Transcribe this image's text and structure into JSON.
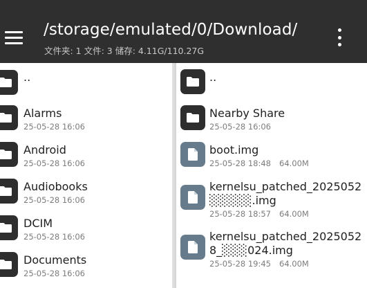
{
  "header": {
    "path": "/storage/emulated/0/Download/",
    "summary": "文件夹: 1  文件: 3  储存: 4.11G/110.27G",
    "menu_icon": "hamburger-menu-icon",
    "more_icon": "more-vertical-icon"
  },
  "left_pane": {
    "items": [
      {
        "name": "..",
        "date": "",
        "size": "",
        "icon": "folder-icon"
      },
      {
        "name": "Alarms",
        "date": "25-05-28 16:06",
        "size": "",
        "icon": "folder-icon"
      },
      {
        "name": "Android",
        "date": "25-05-28 16:06",
        "size": "",
        "icon": "folder-icon"
      },
      {
        "name": "Audiobooks",
        "date": "25-05-28 16:06",
        "size": "",
        "icon": "folder-icon"
      },
      {
        "name": "DCIM",
        "date": "25-05-28 16:06",
        "size": "",
        "icon": "folder-icon"
      },
      {
        "name": "Documents",
        "date": "25-05-28 16:06",
        "size": "",
        "icon": "folder-icon"
      }
    ]
  },
  "right_pane": {
    "items": [
      {
        "name": "..",
        "date": "",
        "size": "",
        "icon": "folder-icon"
      },
      {
        "name": "Nearby Share",
        "date": "25-05-28 16:06",
        "size": "",
        "icon": "folder-icon"
      },
      {
        "name": "boot.img",
        "date": "25-05-28 18:48",
        "size": "64.00M",
        "icon": "file-icon"
      },
      {
        "name_line1": "kernelsu_patched_2025052",
        "name_line2": "░░░░░.img",
        "date": "25-05-28 18:57",
        "size": "64.00M",
        "icon": "file-icon"
      },
      {
        "name_line1": "kernelsu_patched_2025052",
        "name_line2": "8_░░░024.img",
        "date": "25-05-28 19:45",
        "size": "64.00M",
        "icon": "file-icon"
      }
    ]
  },
  "colors": {
    "appbar": "#2f2f2f",
    "folder_icon_bg": "#2e2e2e",
    "file_icon_bg": "#667c8c",
    "pane_bg": "#ffffff"
  }
}
